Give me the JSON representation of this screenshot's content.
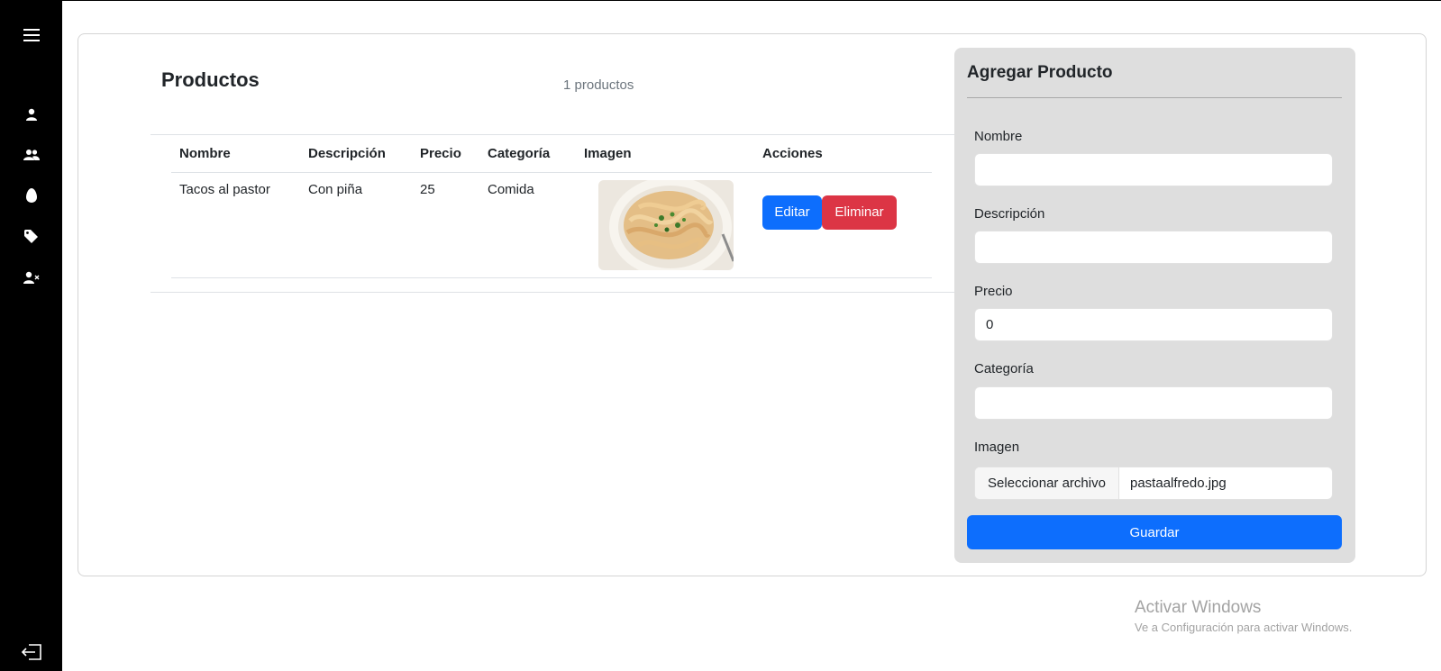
{
  "sidebar": {
    "items": [
      {
        "icon": "menu-icon"
      },
      {
        "icon": "user-icon"
      },
      {
        "icon": "users-icon"
      },
      {
        "icon": "egg-icon"
      },
      {
        "icon": "tag-icon"
      },
      {
        "icon": "user-remove-icon"
      },
      {
        "icon": "logout-icon"
      }
    ],
    "background": "#000000"
  },
  "main": {
    "title": "Productos",
    "count_text": "1 productos",
    "table": {
      "headers": [
        "Nombre",
        "Descripción",
        "Precio",
        "Categoría",
        "Imagen",
        "Acciones"
      ],
      "rows": [
        {
          "nombre": "Tacos al pastor",
          "descripcion": "Con piña",
          "precio": "25",
          "categoria": "Comida",
          "imagen": "pasta-image",
          "edit_label": "Editar",
          "delete_label": "Eliminar"
        }
      ]
    }
  },
  "form": {
    "title": "Agregar Producto",
    "nombre_label": "Nombre",
    "nombre_value": "",
    "descripcion_label": "Descripción",
    "descripcion_value": "",
    "precio_label": "Precio",
    "precio_value": "0",
    "categoria_label": "Categoría",
    "categoria_value": "",
    "imagen_label": "Imagen",
    "file_button_label": "Seleccionar archivo",
    "file_name": "pastaalfredo.jpg",
    "save_label": "Guardar"
  },
  "watermark": {
    "title": "Activar Windows",
    "subtitle": "Ve a Configuración para activar Windows."
  },
  "colors": {
    "primary": "#0d6efd",
    "danger": "#dc3545",
    "panel": "#dedede"
  }
}
